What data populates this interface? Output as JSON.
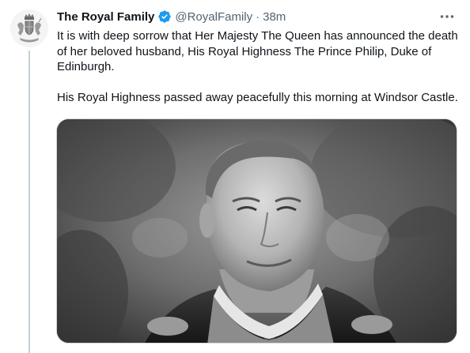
{
  "tweet": {
    "display_name": "The Royal Family",
    "handle": "@RoyalFamily",
    "separator": "·",
    "time": "38m",
    "paragraphs": [
      "It is with deep sorrow that Her Majesty The Queen has announced the death of her beloved husband, His Royal Highness The Prince Philip, Duke of Edinburgh.",
      "His Royal Highness passed away peacefully this morning at Windsor Castle."
    ]
  },
  "icons": {
    "avatar": "royal-coat-of-arms-icon",
    "verified": "verified-badge-icon",
    "more": "more-options-icon"
  },
  "colors": {
    "verified_blue": "#1d9bf0",
    "secondary_text": "#536471",
    "primary_text": "#0f1419",
    "thread_line": "#c4cfd6"
  }
}
